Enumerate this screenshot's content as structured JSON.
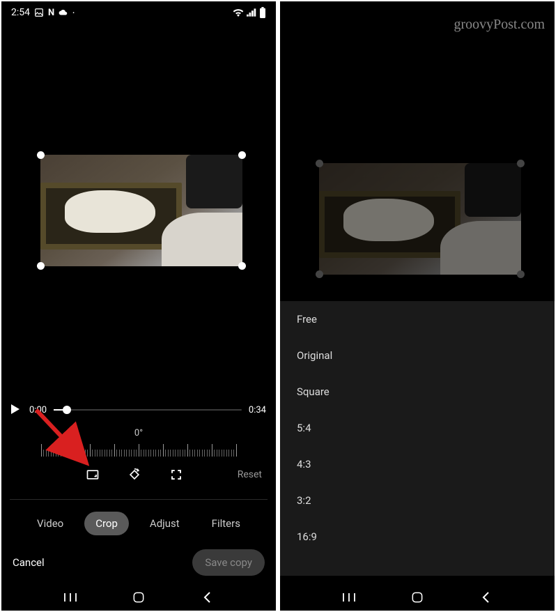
{
  "statusBar": {
    "time": "2:54",
    "icons": [
      "image-icon",
      "netflix-icon",
      "cloud-icon"
    ],
    "rightIcons": [
      "wifi-icon",
      "signal-icon",
      "battery-icon"
    ]
  },
  "watermark": "groovyPost.com",
  "playback": {
    "currentTime": "0:00",
    "duration": "0:34"
  },
  "rotation": {
    "angle": "0°"
  },
  "tools": {
    "reset": "Reset"
  },
  "tabs": {
    "video": "Video",
    "crop": "Crop",
    "adjust": "Adjust",
    "filters": "Filters"
  },
  "actions": {
    "cancel": "Cancel",
    "save": "Save copy"
  },
  "aspectRatios": {
    "items": [
      "Free",
      "Original",
      "Square",
      "5:4",
      "4:3",
      "3:2",
      "16:9"
    ]
  }
}
